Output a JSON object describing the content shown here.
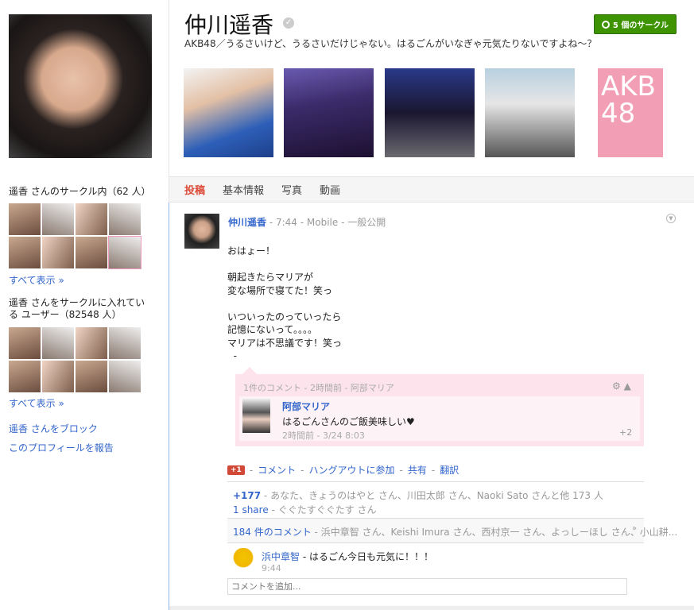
{
  "profile": {
    "name": "仲川遥香",
    "tagline": "AKB48／うるさいけど、うるさいだけじゃない。はるごんがいなぎゃ元気たりないですよね～？",
    "circles_button": "5 個のサークル",
    "verified_icon": "✓"
  },
  "sidebar": {
    "in_circles": "遥香 さんのサークル内（62 人）",
    "show_all": "すべて表示 »",
    "have_in_circles": "遥香 さんをサークルに入れている ユーザー（82548 人）",
    "show_all_2": "すべて表示 »",
    "block": "遥香 さんをブロック",
    "report": "このプロフィールを報告"
  },
  "photos": {
    "logo_text": "AKB 48"
  },
  "tabs": [
    "投稿",
    "基本情報",
    "写真",
    "動画"
  ],
  "post": {
    "author": "仲川遥香",
    "time": "7:44",
    "source": "Mobile",
    "visibility": "一般公開",
    "body": "おはょー！\n\n朝起きたらマリアが\n変な場所で寝てた！笑っ\n\nいついったのっていったら\n記憶にないって。。。。\nマリアは不思議です！笑っ\n  -",
    "comment_box": {
      "header": "1件のコメント - 2時間前 - 阿部マリア",
      "author": "阿部マリア",
      "text": "はるごんさんのご飯美味しい♥",
      "time": "2時間前 - 3/24 8:03",
      "plus": "+2"
    },
    "actions": {
      "plusone": "+1",
      "comment": "コメント",
      "hangout": "ハングアウトに参加",
      "share": "共有",
      "translate": "翻訳"
    },
    "plus_count": "+177",
    "plus_people": "あなた、きょうのはやと さん、川田太郎 さん、Naoki Sato さんと他 173 人",
    "share_count": "1 share",
    "share_people": "ぐぐたすぐぐたす さん",
    "comment_count": "184 件のコメント",
    "comment_people": "浜中章智 さん、Keishi Imura さん、西村京一 さん、よっしーほし さん、小山耕...",
    "last_comment": {
      "author": "浜中章智",
      "text": "はるごん今日も元気に！！！",
      "time": "9:44"
    },
    "comment_placeholder": "コメントを追加..."
  }
}
